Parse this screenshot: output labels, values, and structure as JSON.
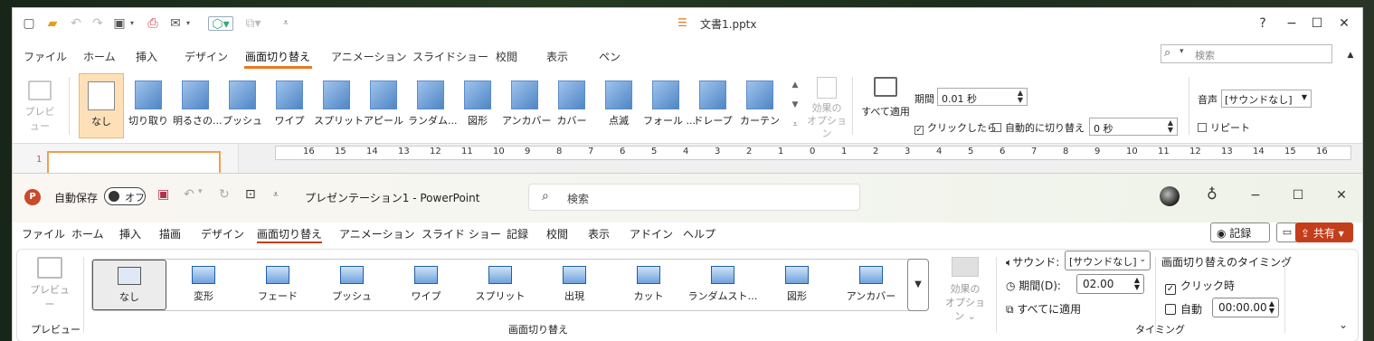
{
  "w1": {
    "title": "文書1.pptx",
    "tabs": [
      "ファイル",
      "ホーム",
      "挿入",
      "デザイン",
      "画面切り替え",
      "アニメーション",
      "スライドショー",
      "校閲",
      "表示",
      "ペン"
    ],
    "search_placeholder": "検索",
    "preview_label": "プレビュー",
    "transitions": [
      "なし",
      "切り取り",
      "明るさの...",
      "プッシュ",
      "ワイプ",
      "スプリット",
      "アピール",
      "ランダム...",
      "図形",
      "アンカバー",
      "カバー",
      "点滅",
      "フォール ...",
      "ドレープ",
      "カーテン"
    ],
    "effect_options": [
      "効果の",
      "オプション"
    ],
    "apply_all": "すべて適用",
    "duration_label": "期間",
    "duration_value": "0.01 秒",
    "on_click": "クリックしたら",
    "auto_advance": "自動的に切り替え",
    "auto_value": "0 秒",
    "sound_label": "音声",
    "sound_value": "[サウンドなし]",
    "repeat": "リピート",
    "slide_number": "1",
    "ruler": [
      "16",
      "15",
      "14",
      "13",
      "12",
      "11",
      "10",
      "9",
      "8",
      "7",
      "6",
      "5",
      "4",
      "3",
      "2",
      "1",
      "0",
      "1",
      "2",
      "3",
      "4",
      "5",
      "6",
      "7",
      "8",
      "9",
      "10",
      "11",
      "12",
      "13",
      "14",
      "15",
      "16"
    ]
  },
  "w2": {
    "autosave": "自動保存",
    "autosave_state": "オフ",
    "doc_title": "プレゼンテーション1 - PowerPoint",
    "search_placeholder": "検索",
    "tabs": [
      "ファイル",
      "ホーム",
      "挿入",
      "描画",
      "デザイン",
      "画面切り替え",
      "アニメーション",
      "スライド ショー",
      "記録",
      "校閲",
      "表示",
      "アドイン",
      "ヘルプ"
    ],
    "record": "記録",
    "share": "共有",
    "preview_label": "プレビュー",
    "transitions": [
      "なし",
      "変形",
      "フェード",
      "プッシュ",
      "ワイプ",
      "スプリット",
      "出現",
      "カット",
      "ランダムスト…",
      "図形",
      "アンカバー"
    ],
    "effect_options": [
      "効果の",
      "オプション"
    ],
    "sound_label": "サウンド:",
    "sound_value": "[サウンドなし]",
    "duration_label": "期間(D):",
    "duration_value": "02.00",
    "apply_all": "すべてに適用",
    "timing_title": "画面切り替えのタイミング",
    "on_click": "クリック時",
    "auto": "自動",
    "auto_value": "00:00.00",
    "group_preview": "プレビュー",
    "group_transitions": "画面切り替え",
    "group_timing": "タイミング"
  }
}
